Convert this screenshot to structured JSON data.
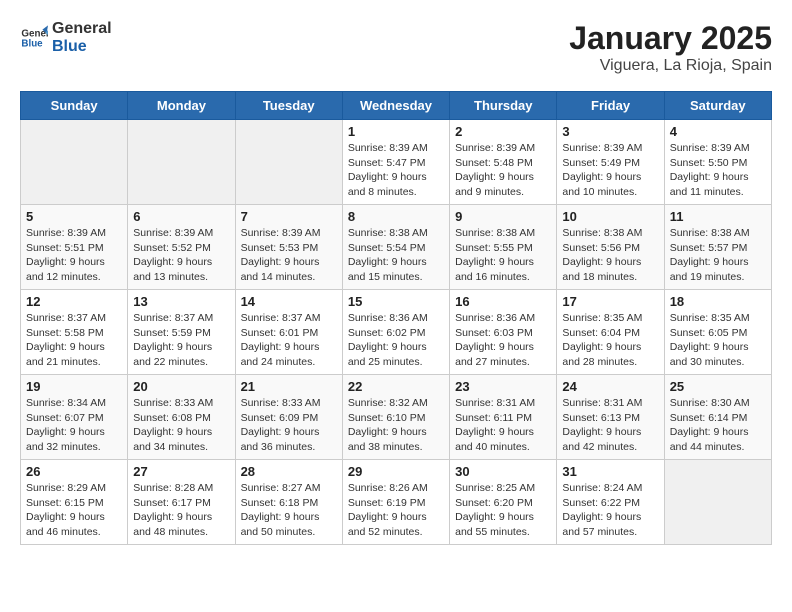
{
  "logo": {
    "line1": "General",
    "line2": "Blue"
  },
  "title": "January 2025",
  "location": "Viguera, La Rioja, Spain",
  "days_of_week": [
    "Sunday",
    "Monday",
    "Tuesday",
    "Wednesday",
    "Thursday",
    "Friday",
    "Saturday"
  ],
  "weeks": [
    [
      {
        "day": "",
        "info": ""
      },
      {
        "day": "",
        "info": ""
      },
      {
        "day": "",
        "info": ""
      },
      {
        "day": "1",
        "info": "Sunrise: 8:39 AM\nSunset: 5:47 PM\nDaylight: 9 hours\nand 8 minutes."
      },
      {
        "day": "2",
        "info": "Sunrise: 8:39 AM\nSunset: 5:48 PM\nDaylight: 9 hours\nand 9 minutes."
      },
      {
        "day": "3",
        "info": "Sunrise: 8:39 AM\nSunset: 5:49 PM\nDaylight: 9 hours\nand 10 minutes."
      },
      {
        "day": "4",
        "info": "Sunrise: 8:39 AM\nSunset: 5:50 PM\nDaylight: 9 hours\nand 11 minutes."
      }
    ],
    [
      {
        "day": "5",
        "info": "Sunrise: 8:39 AM\nSunset: 5:51 PM\nDaylight: 9 hours\nand 12 minutes."
      },
      {
        "day": "6",
        "info": "Sunrise: 8:39 AM\nSunset: 5:52 PM\nDaylight: 9 hours\nand 13 minutes."
      },
      {
        "day": "7",
        "info": "Sunrise: 8:39 AM\nSunset: 5:53 PM\nDaylight: 9 hours\nand 14 minutes."
      },
      {
        "day": "8",
        "info": "Sunrise: 8:38 AM\nSunset: 5:54 PM\nDaylight: 9 hours\nand 15 minutes."
      },
      {
        "day": "9",
        "info": "Sunrise: 8:38 AM\nSunset: 5:55 PM\nDaylight: 9 hours\nand 16 minutes."
      },
      {
        "day": "10",
        "info": "Sunrise: 8:38 AM\nSunset: 5:56 PM\nDaylight: 9 hours\nand 18 minutes."
      },
      {
        "day": "11",
        "info": "Sunrise: 8:38 AM\nSunset: 5:57 PM\nDaylight: 9 hours\nand 19 minutes."
      }
    ],
    [
      {
        "day": "12",
        "info": "Sunrise: 8:37 AM\nSunset: 5:58 PM\nDaylight: 9 hours\nand 21 minutes."
      },
      {
        "day": "13",
        "info": "Sunrise: 8:37 AM\nSunset: 5:59 PM\nDaylight: 9 hours\nand 22 minutes."
      },
      {
        "day": "14",
        "info": "Sunrise: 8:37 AM\nSunset: 6:01 PM\nDaylight: 9 hours\nand 24 minutes."
      },
      {
        "day": "15",
        "info": "Sunrise: 8:36 AM\nSunset: 6:02 PM\nDaylight: 9 hours\nand 25 minutes."
      },
      {
        "day": "16",
        "info": "Sunrise: 8:36 AM\nSunset: 6:03 PM\nDaylight: 9 hours\nand 27 minutes."
      },
      {
        "day": "17",
        "info": "Sunrise: 8:35 AM\nSunset: 6:04 PM\nDaylight: 9 hours\nand 28 minutes."
      },
      {
        "day": "18",
        "info": "Sunrise: 8:35 AM\nSunset: 6:05 PM\nDaylight: 9 hours\nand 30 minutes."
      }
    ],
    [
      {
        "day": "19",
        "info": "Sunrise: 8:34 AM\nSunset: 6:07 PM\nDaylight: 9 hours\nand 32 minutes."
      },
      {
        "day": "20",
        "info": "Sunrise: 8:33 AM\nSunset: 6:08 PM\nDaylight: 9 hours\nand 34 minutes."
      },
      {
        "day": "21",
        "info": "Sunrise: 8:33 AM\nSunset: 6:09 PM\nDaylight: 9 hours\nand 36 minutes."
      },
      {
        "day": "22",
        "info": "Sunrise: 8:32 AM\nSunset: 6:10 PM\nDaylight: 9 hours\nand 38 minutes."
      },
      {
        "day": "23",
        "info": "Sunrise: 8:31 AM\nSunset: 6:11 PM\nDaylight: 9 hours\nand 40 minutes."
      },
      {
        "day": "24",
        "info": "Sunrise: 8:31 AM\nSunset: 6:13 PM\nDaylight: 9 hours\nand 42 minutes."
      },
      {
        "day": "25",
        "info": "Sunrise: 8:30 AM\nSunset: 6:14 PM\nDaylight: 9 hours\nand 44 minutes."
      }
    ],
    [
      {
        "day": "26",
        "info": "Sunrise: 8:29 AM\nSunset: 6:15 PM\nDaylight: 9 hours\nand 46 minutes."
      },
      {
        "day": "27",
        "info": "Sunrise: 8:28 AM\nSunset: 6:17 PM\nDaylight: 9 hours\nand 48 minutes."
      },
      {
        "day": "28",
        "info": "Sunrise: 8:27 AM\nSunset: 6:18 PM\nDaylight: 9 hours\nand 50 minutes."
      },
      {
        "day": "29",
        "info": "Sunrise: 8:26 AM\nSunset: 6:19 PM\nDaylight: 9 hours\nand 52 minutes."
      },
      {
        "day": "30",
        "info": "Sunrise: 8:25 AM\nSunset: 6:20 PM\nDaylight: 9 hours\nand 55 minutes."
      },
      {
        "day": "31",
        "info": "Sunrise: 8:24 AM\nSunset: 6:22 PM\nDaylight: 9 hours\nand 57 minutes."
      },
      {
        "day": "",
        "info": ""
      }
    ]
  ]
}
